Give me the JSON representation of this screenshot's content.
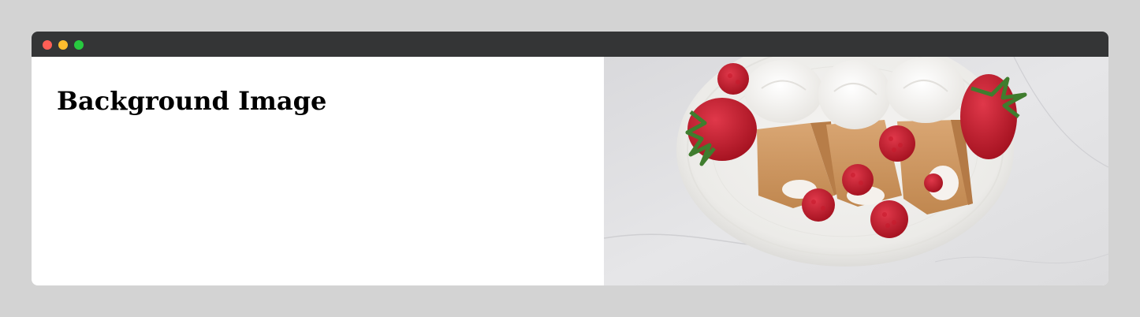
{
  "window": {
    "controls": [
      {
        "name": "close-dot",
        "color": "#ff5f56"
      },
      {
        "name": "minimize-dot",
        "color": "#ffbd2e"
      },
      {
        "name": "maximize-dot",
        "color": "#27c93f"
      }
    ],
    "titlebar_color": "#343536"
  },
  "page": {
    "heading": "Background Image"
  },
  "image": {
    "icon": "crepes-with-strawberries-raspberries-and-whipped-cream-photo"
  }
}
